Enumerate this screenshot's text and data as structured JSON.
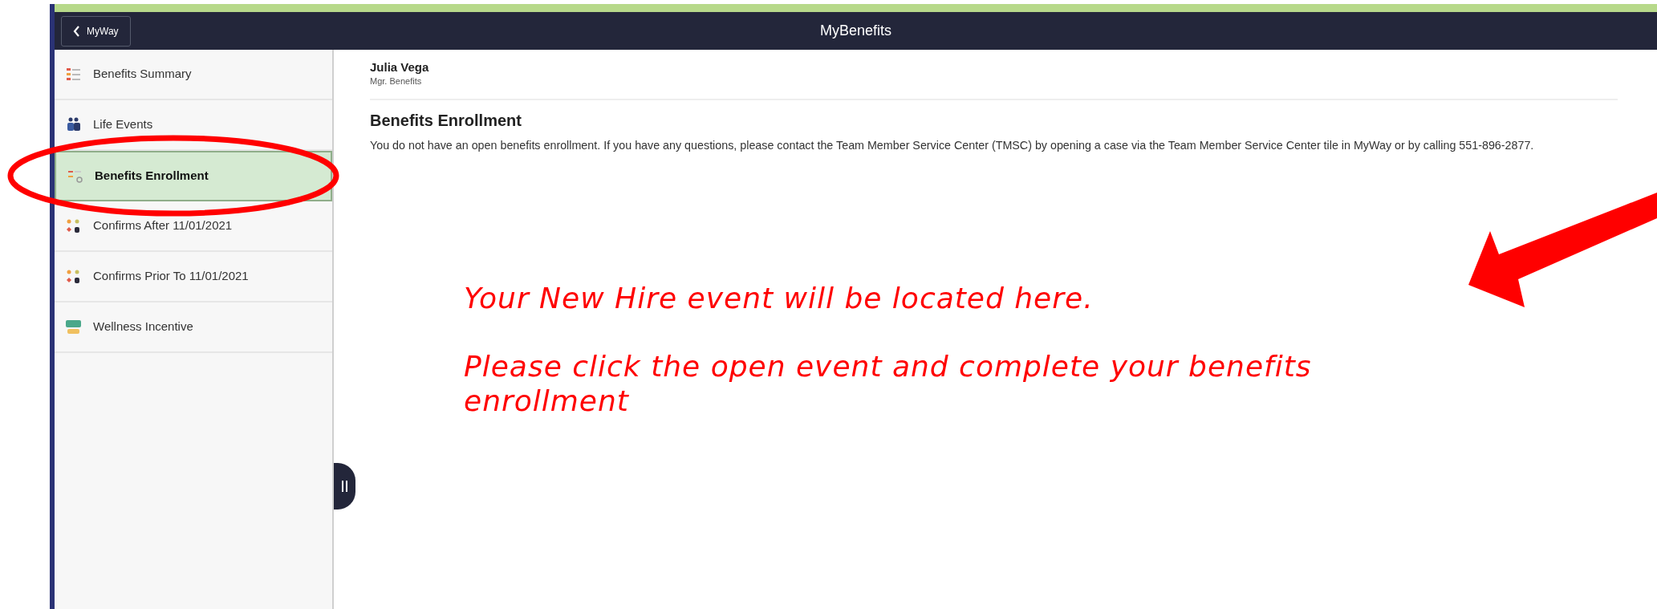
{
  "header": {
    "back_button": "MyWay",
    "title": "MyBenefits"
  },
  "sidebar": {
    "items": [
      {
        "label": "Benefits Summary",
        "selected": false
      },
      {
        "label": "Life Events",
        "selected": false
      },
      {
        "label": "Benefits Enrollment",
        "selected": true
      },
      {
        "label": "Confirms After 11/01/2021",
        "selected": false
      },
      {
        "label": "Confirms Prior To 11/01/2021",
        "selected": false
      },
      {
        "label": "Wellness Incentive",
        "selected": false
      }
    ]
  },
  "user": {
    "name": "Julia Vega",
    "job_title": "Mgr. Benefits"
  },
  "page_title": "Benefits Enrollment",
  "message": "You do not have an open benefits enrollment. If you have any questions, please contact the Team Member Service Center (TMSC) by opening a case via the Team Member Service Center tile in MyWay or by calling 551-896-2877.",
  "annotation": {
    "lines": [
      "Your New Hire event will be located here.",
      "Please click the open event and complete your benefits enrollment"
    ]
  }
}
